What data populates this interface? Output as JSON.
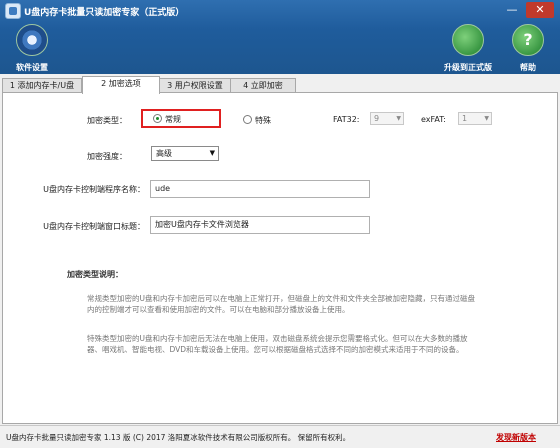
{
  "window": {
    "title": "U盘内存卡批量只读加密专家（正式版）",
    "minimize": "—",
    "close": "✕"
  },
  "toolbar": {
    "settings_label": "软件设置",
    "upgrade_label": "升级到正式版",
    "help_label": "帮助",
    "help_glyph": "?"
  },
  "tabs": [
    {
      "label": "1 添加内存卡/U盘",
      "active": false
    },
    {
      "label": "2 加密选项",
      "active": true
    },
    {
      "label": "3 用户权限设置",
      "active": false
    },
    {
      "label": "4 立即加密",
      "active": false
    }
  ],
  "encrypt": {
    "type_label": "加密类型：",
    "option_normal": "常规",
    "option_special": "特殊",
    "selected": "常规",
    "fat32_label": "FAT32:",
    "fat32_value": "9",
    "exfat_label": "exFAT:",
    "exfat_value": "1",
    "strength_label": "加密强度：",
    "strength_value": "高级",
    "program_name_label": "U盘内存卡控制端程序名称：",
    "program_name_value": "ude",
    "window_title_label": "U盘内存卡控制端窗口标题：",
    "window_title_value": "加密U盘内存卡文件浏览器"
  },
  "description": {
    "heading": "加密类型说明：",
    "normal_text": "常规类型加密的U盘和内存卡加密后可以在电脑上正常打开，但磁盘上的文件和文件夹全部被加密隐藏，只有通过磁盘内的控制端才可以查看和使用加密的文件。可以在电脑和部分播放设备上使用。",
    "special_text": "特殊类型加密的U盘和内存卡加密后无法在电脑上使用，双击磁盘系统会提示您需要格式化。但可以在大多数的播放器、唱戏机、智能电视、DVD和车载设备上使用。您可以根据磁盘格式选择不同的加密模式来适用于不同的设备。"
  },
  "footer": {
    "copyright": "U盘内存卡批量只读加密专家 1.13 版 (C) 2017 洛阳夏冰软件技术有限公司版权所有。 保留所有权利。",
    "new_version_link": "发现新版本"
  }
}
